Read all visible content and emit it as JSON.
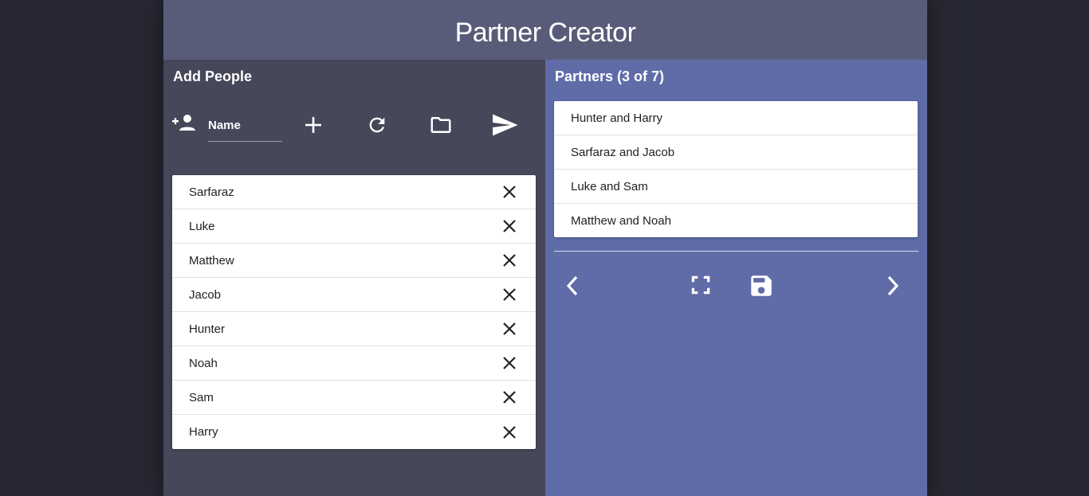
{
  "app": {
    "title": "Partner Creator"
  },
  "add_people": {
    "title": "Add People",
    "name_placeholder": "Name",
    "icons": [
      "add-person-icon",
      "plus-icon",
      "refresh-icon",
      "folder-icon",
      "send-icon"
    ],
    "people": [
      "Sarfaraz",
      "Luke",
      "Matthew",
      "Jacob",
      "Hunter",
      "Noah",
      "Sam",
      "Harry"
    ]
  },
  "partners": {
    "title": "Partners (3 of 7)",
    "pairs": [
      "Hunter and Harry",
      "Sarfaraz and Jacob",
      "Luke and Sam",
      "Matthew and Noah"
    ],
    "icons": [
      "chevron-left-icon",
      "fullscreen-icon",
      "save-icon",
      "chevron-right-icon"
    ]
  },
  "colors": {
    "background": "#272833",
    "header": "#595c78",
    "left_panel": "#464759",
    "right_panel": "#5f6ca8"
  }
}
